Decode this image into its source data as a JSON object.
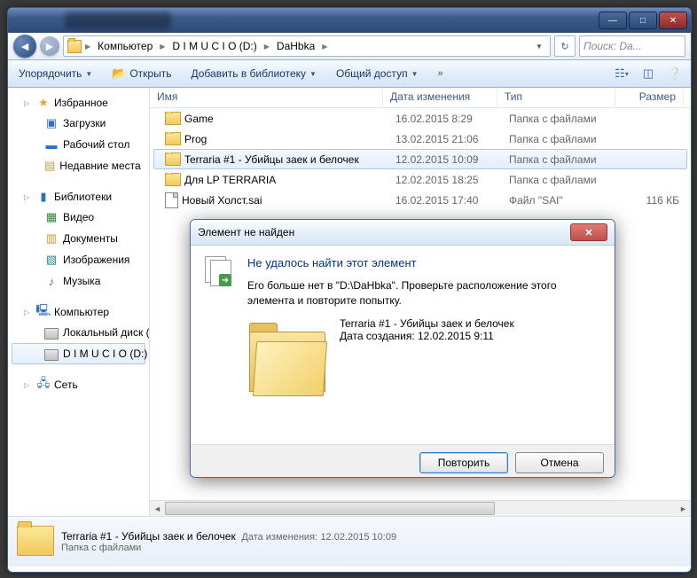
{
  "window": {
    "controls": {
      "min": "—",
      "max": "□",
      "close": "✕"
    }
  },
  "breadcrumb": [
    "Компьютер",
    "D I M U C I O (D:)",
    "DaHbka"
  ],
  "search_placeholder": "Поиск: Da...",
  "toolbar": {
    "organize": "Упорядочить",
    "open": "Открыть",
    "add_library": "Добавить в библиотеку",
    "share": "Общий доступ"
  },
  "columns": {
    "name": "Имя",
    "date": "Дата изменения",
    "type": "Тип",
    "size": "Размер"
  },
  "sidebar": {
    "favorites": {
      "label": "Избранное",
      "items": [
        "Загрузки",
        "Рабочий стол",
        "Недавние места"
      ],
      "icons": [
        "⬇",
        "🖥",
        "📋"
      ]
    },
    "libraries": {
      "label": "Библиотеки",
      "items": [
        "Видео",
        "Документы",
        "Изображения",
        "Музыка"
      ],
      "icons": [
        "🎞",
        "📄",
        "🖼",
        "🎵"
      ]
    },
    "computer": {
      "label": "Компьютер",
      "items": [
        "Локальный диск (C:)",
        "D I M U C I O (D:)"
      ]
    },
    "network": {
      "label": "Сеть"
    }
  },
  "files": [
    {
      "name": "Game",
      "date": "16.02.2015 8:29",
      "type": "Папка с файлами",
      "size": "",
      "kind": "folder"
    },
    {
      "name": "Prog",
      "date": "13.02.2015 21:06",
      "type": "Папка с файлами",
      "size": "",
      "kind": "folder"
    },
    {
      "name": "Terraria #1 - Убийцы заек и белочек",
      "date": "12.02.2015 10:09",
      "type": "Папка с файлами",
      "size": "",
      "kind": "folder",
      "selected": true
    },
    {
      "name": "Для LP TERRARIA",
      "date": "12.02.2015 18:25",
      "type": "Папка с файлами",
      "size": "",
      "kind": "folder"
    },
    {
      "name": "Новый Холст.sai",
      "date": "16.02.2015 17:40",
      "type": "Файл \"SAI\"",
      "size": "116 КБ",
      "kind": "file"
    }
  ],
  "status": {
    "title": "Terraria #1 - Убийцы заек и белочек",
    "date_label": "Дата изменения:",
    "date": "12.02.2015 10:09",
    "type": "Папка с файлами"
  },
  "dialog": {
    "title": "Элемент не найден",
    "heading": "Не удалось найти этот элемент",
    "message": "Его больше нет в \"D:\\DaHbka\". Проверьте расположение этого элемента и повторите попытку.",
    "item_name": "Terraria #1 - Убийцы заек и белочек",
    "created_label": "Дата создания: 12.02.2015 9:11",
    "retry": "Повторить",
    "cancel": "Отмена"
  }
}
